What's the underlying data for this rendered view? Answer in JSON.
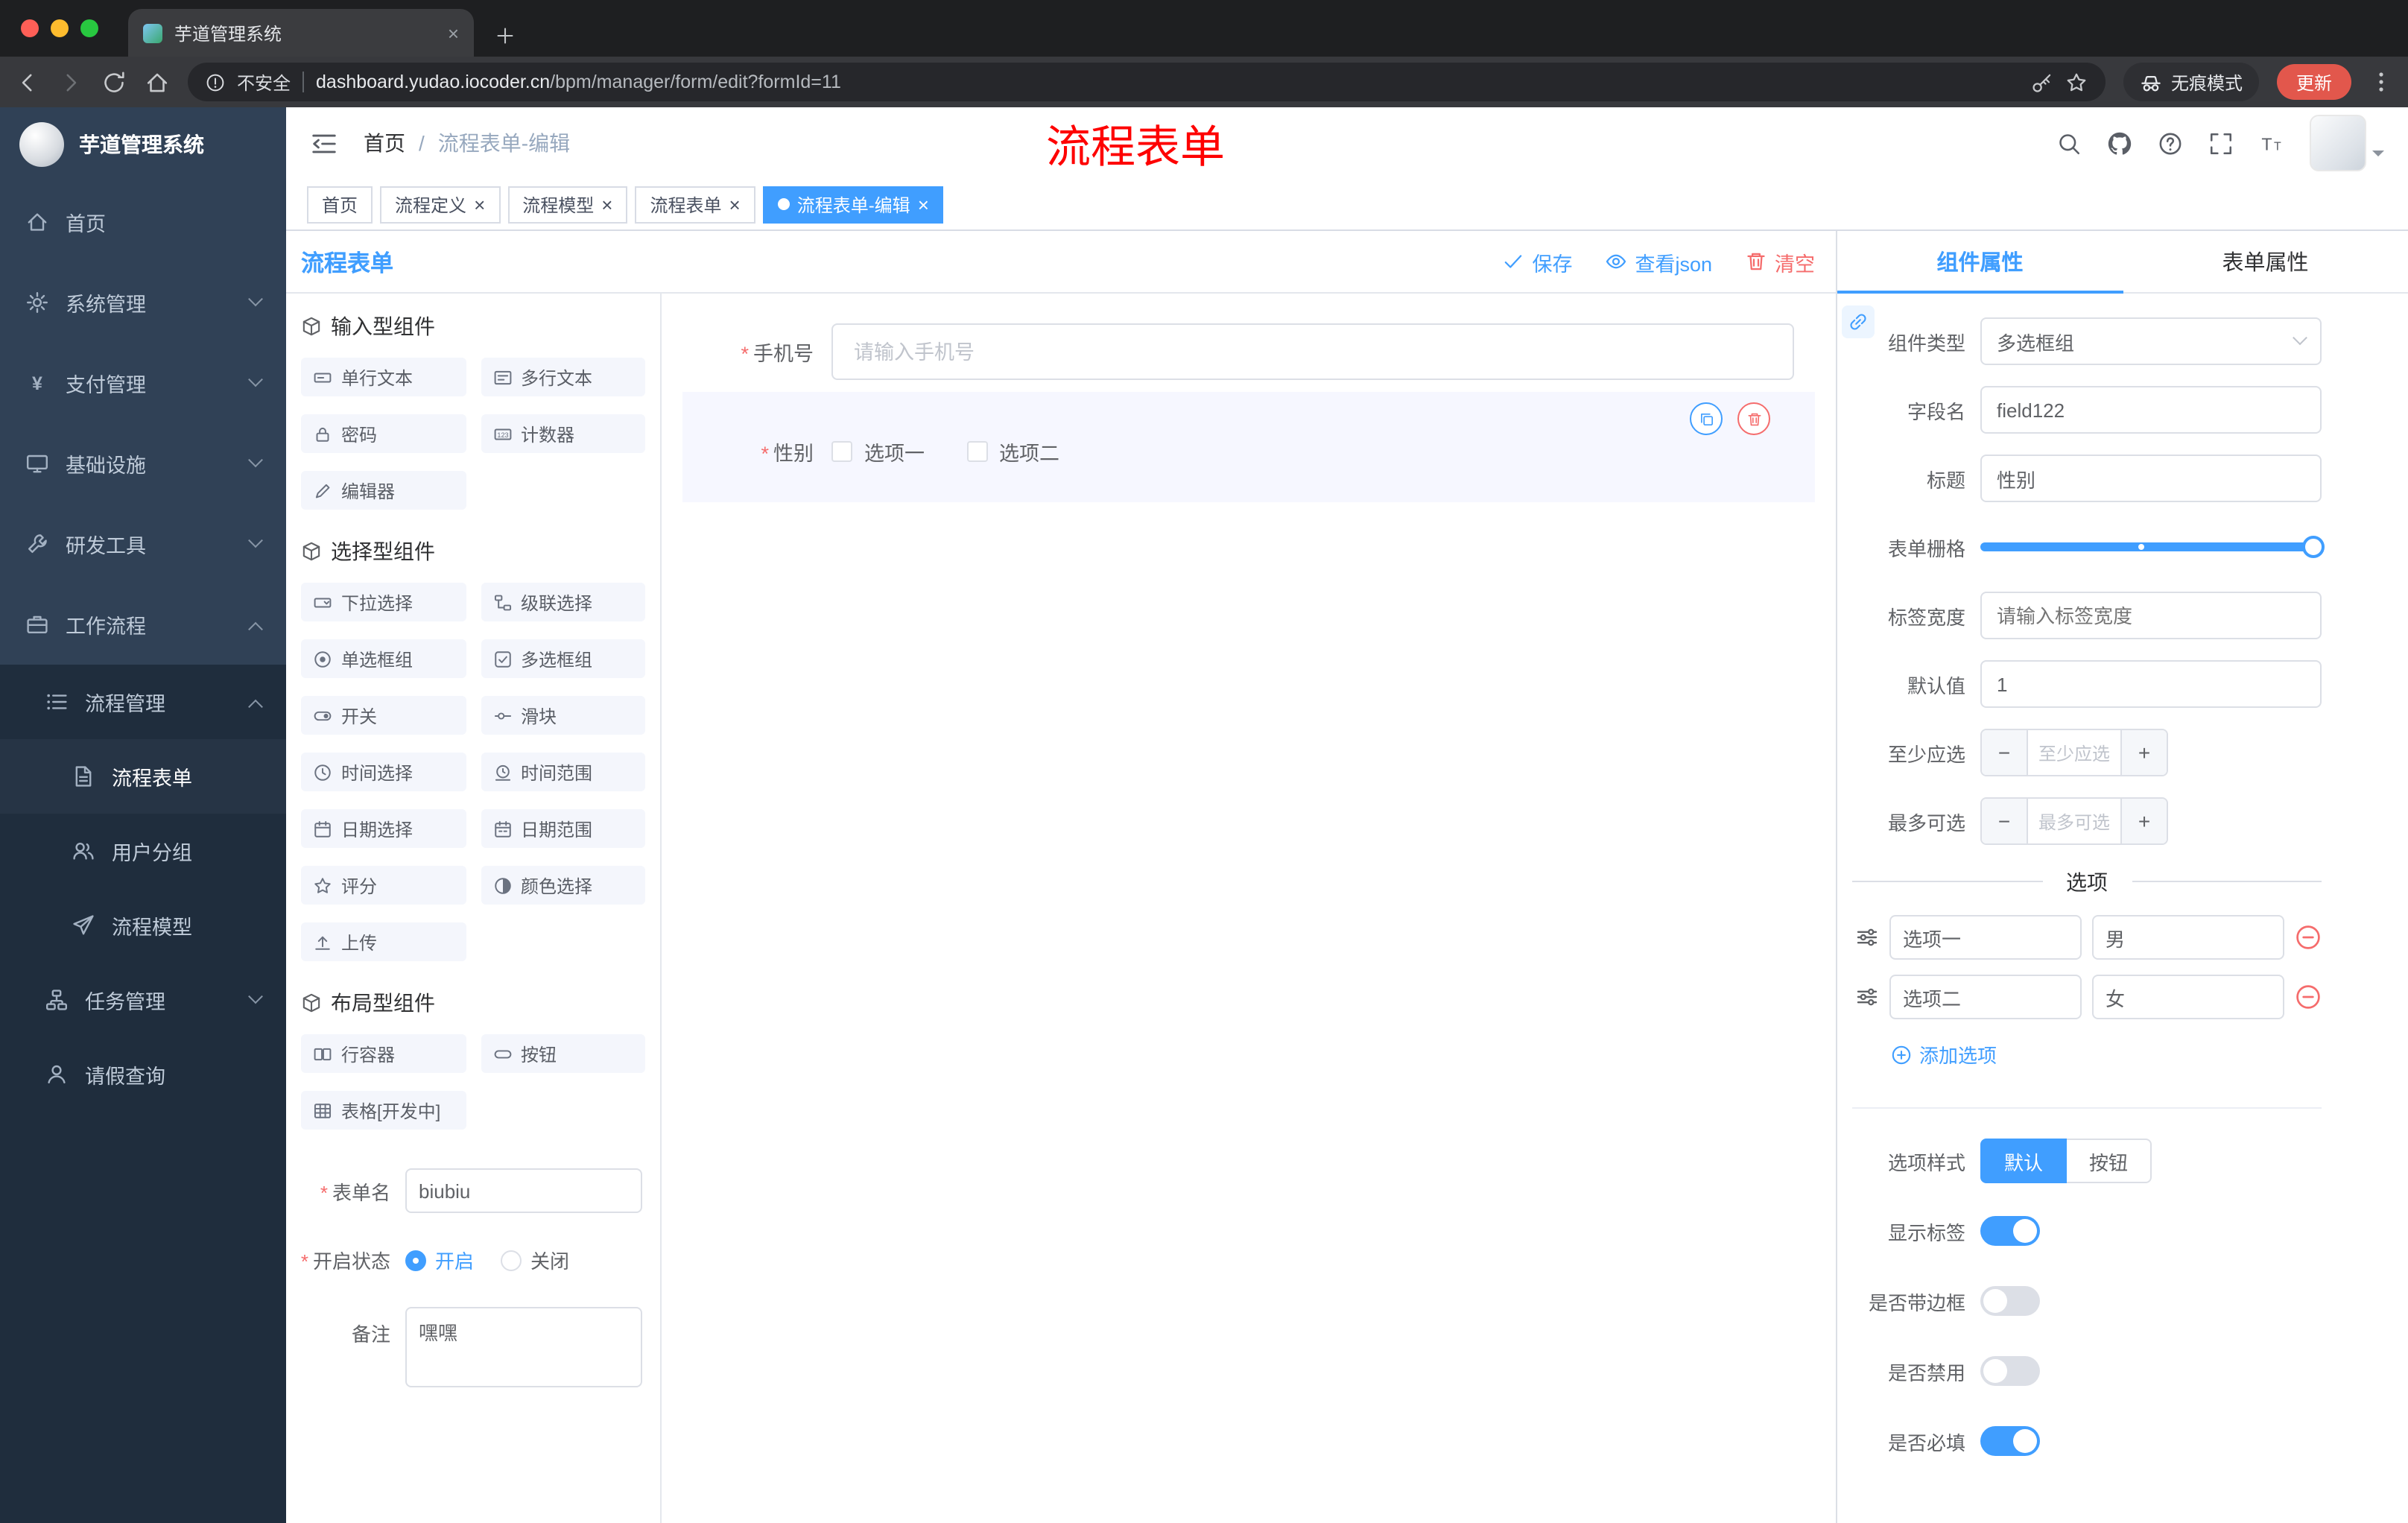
{
  "browser": {
    "tab_title": "芋道管理系统",
    "security_label": "不安全",
    "url_domain": "dashboard.yudao.iocoder.cn",
    "url_path": "/bpm/manager/form/edit?formId=11",
    "incognito_label": "无痕模式",
    "update_label": "更新"
  },
  "sidebar": {
    "title": "芋道管理系统",
    "items": [
      {
        "label": "首页"
      },
      {
        "label": "系统管理"
      },
      {
        "label": "支付管理"
      },
      {
        "label": "基础设施"
      },
      {
        "label": "研发工具"
      },
      {
        "label": "工作流程"
      },
      {
        "label": "流程管理"
      },
      {
        "label": "流程表单"
      },
      {
        "label": "用户分组"
      },
      {
        "label": "流程模型"
      },
      {
        "label": "任务管理"
      },
      {
        "label": "请假查询"
      }
    ]
  },
  "header": {
    "breadcrumb": {
      "home": "首页",
      "current": "流程表单-编辑"
    },
    "annotation": "流程表单"
  },
  "tags": [
    {
      "label": "首页"
    },
    {
      "label": "流程定义"
    },
    {
      "label": "流程模型"
    },
    {
      "label": "流程表单"
    },
    {
      "label": "流程表单-编辑"
    }
  ],
  "designer": {
    "title": "流程表单",
    "toolbar": {
      "save": "保存",
      "view_json": "查看json",
      "clear": "清空"
    },
    "palette": {
      "groups": [
        {
          "title": "输入型组件",
          "items": [
            "单行文本",
            "多行文本",
            "密码",
            "计数器",
            "编辑器"
          ]
        },
        {
          "title": "选择型组件",
          "items": [
            "下拉选择",
            "级联选择",
            "单选框组",
            "多选框组",
            "开关",
            "滑块",
            "时间选择",
            "时间范围",
            "日期选择",
            "日期范围",
            "评分",
            "颜色选择",
            "上传"
          ]
        },
        {
          "title": "布局型组件",
          "items": [
            "行容器",
            "按钮",
            "表格[开发中]"
          ]
        }
      ]
    },
    "meta": {
      "name_label": "表单名",
      "name_value": "biubiu",
      "status_label": "开启状态",
      "status_on": "开启",
      "status_off": "关闭",
      "remark_label": "备注",
      "remark_value": "嘿嘿"
    },
    "canvas": {
      "phone_label": "手机号",
      "phone_placeholder": "请输入手机号",
      "gender_label": "性别",
      "gender_options": [
        "选项一",
        "选项二"
      ]
    }
  },
  "properties": {
    "tab_component": "组件属性",
    "tab_form": "表单属性",
    "component_type_label": "组件类型",
    "component_type_value": "多选框组",
    "field_name_label": "字段名",
    "field_name_value": "field122",
    "title_label": "标题",
    "title_value": "性别",
    "grid_label": "表单栅格",
    "label_width_label": "标签宽度",
    "label_width_placeholder": "请输入标签宽度",
    "default_label": "默认值",
    "default_value": "1",
    "min_label": "至少应选",
    "min_placeholder": "至少应选",
    "max_label": "最多可选",
    "max_placeholder": "最多可选",
    "options_title": "选项",
    "options": [
      {
        "label": "选项一",
        "value": "男"
      },
      {
        "label": "选项二",
        "value": "女"
      }
    ],
    "add_option_label": "添加选项",
    "style_label": "选项样式",
    "style_default": "默认",
    "style_button": "按钮",
    "toggles": [
      {
        "label": "显示标签",
        "on": true
      },
      {
        "label": "是否带边框",
        "on": false
      },
      {
        "label": "是否禁用",
        "on": false
      },
      {
        "label": "是否必填",
        "on": true
      }
    ]
  },
  "colors": {
    "accent": "#409eff",
    "danger": "#f56c6c",
    "annotation_red": "#fe0000",
    "sidebar_bg": "#304156",
    "submenu_bg": "#1f2d3d"
  }
}
